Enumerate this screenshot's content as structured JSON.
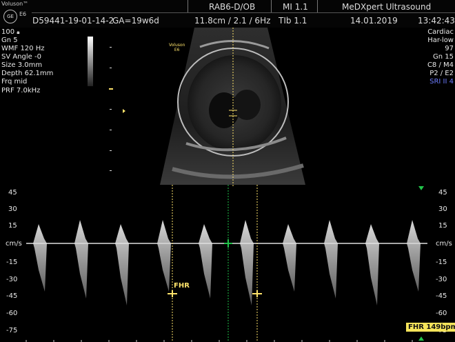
{
  "header": {
    "brand": "Voluson™",
    "logo": "GE",
    "model": "E6",
    "patient_id": "D59441-19-01-14-2",
    "ga": "GA=19w6d",
    "probe": "RAB6-D/OB",
    "depth_info": "11.8cm / 2.1 / 6Hz",
    "mi": "MI  1.1",
    "tib": "TIb  1.1",
    "institution": "MeDXpert Ultrasound",
    "date": "14.01.2019",
    "time": "13:42:43"
  },
  "left_params": [
    "100",
    "Gn  5",
    "WMF 120 Hz",
    "SV Angle -0",
    "Size  3.0mm",
    "Depth 62.1mm",
    "Frq mid",
    "PRF  7.0kHz"
  ],
  "right_params": [
    "Cardiac",
    "Har-low",
    "97",
    "Gn  15",
    "C8 / M4",
    "P2 / E2",
    "SRI II 4"
  ],
  "image_overlay": {
    "brand": "Voluson",
    "model": "E6"
  },
  "doppler": {
    "unit": "cm/s",
    "left_ticks": [
      "45",
      "30",
      "15",
      "-15",
      "-30",
      "-45",
      "-60",
      "-75"
    ],
    "right_ticks": [
      "45",
      "30",
      "15",
      "-15",
      "-30",
      "-45",
      "-60",
      "-75"
    ],
    "cal_label": "FHR",
    "fhr_readout": "FHR 149bpm"
  },
  "colors": {
    "caliper": "#ffe46b",
    "marker": "#21c44a",
    "accent": "#6d7dff"
  }
}
